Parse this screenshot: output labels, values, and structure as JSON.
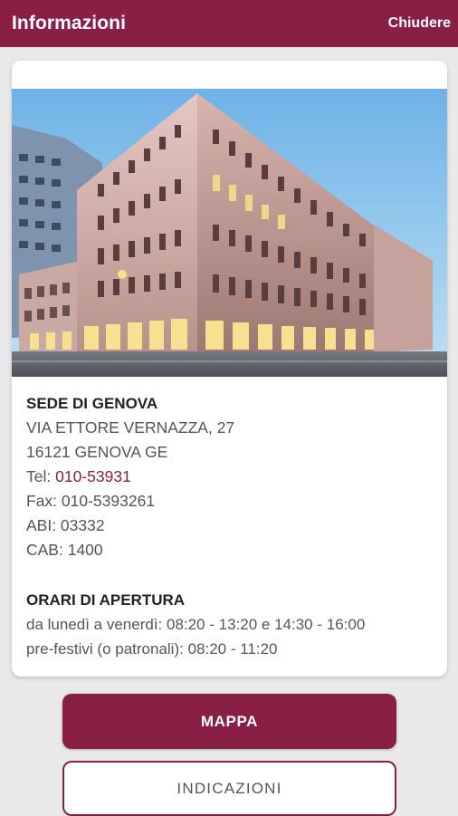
{
  "header": {
    "title": "Informazioni",
    "close_label": "Chiudere"
  },
  "branch": {
    "name": "SEDE DI GENOVA",
    "address_line1": "VIA ETTORE VERNAZZA, 27",
    "address_line2": "16121 GENOVA GE",
    "tel_label": "Tel: ",
    "tel_value": "010-53931",
    "fax": "Fax: 010-5393261",
    "abi": "ABI: 03332",
    "cab": "CAB: 1400"
  },
  "hours": {
    "heading": "ORARI DI APERTURA",
    "weekdays": "da lunedì a venerdì: 08:20 - 13:20 e 14:30 - 16:00",
    "prefestive": "pre-festivi (o patronali): 08:20 - 11:20"
  },
  "buttons": {
    "map_label": "MAPPA",
    "directions_label": "INDICAZIONI"
  },
  "colors": {
    "brand": "#8a1f45",
    "background": "#e9e9e9"
  }
}
